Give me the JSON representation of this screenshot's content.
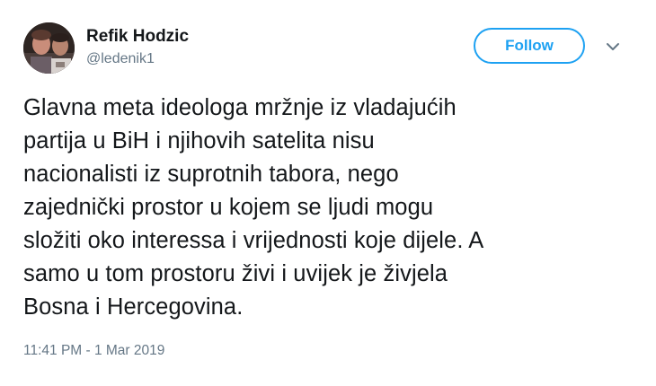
{
  "author": {
    "display_name": "Refik Hodzic",
    "handle": "@ledenik1",
    "avatar_icon": "profile-photo"
  },
  "actions": {
    "follow_label": "Follow",
    "menu_icon": "chevron-down-icon"
  },
  "tweet": {
    "text": "Glavna meta ideologa mržnje iz vladajućih\npartija u BiH i njihovih satelita nisu\nnacionalisti iz suprotnih tabora, nego\nzajednički prostor u kojem se ljudi mogu\nsložiti oko interessa i vrijednosti koje dijele. A\nsamo u tom prostoru živi i uvijek je živjela\nBosna i Hercegovina.",
    "timestamp": "11:41 PM - 1 Mar 2019"
  },
  "colors": {
    "accent": "#1da1f2",
    "text": "#14171a",
    "secondary": "#657786"
  }
}
